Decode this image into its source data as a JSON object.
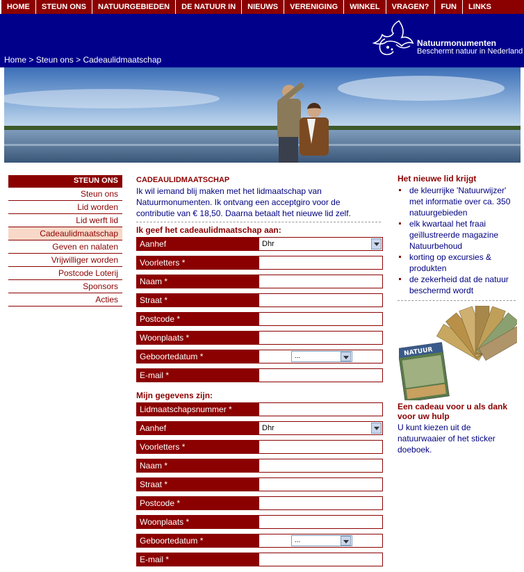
{
  "topnav": [
    "HOME",
    "STEUN ONS",
    "NATUURGEBIEDEN",
    "DE NATUUR IN",
    "NIEUWS",
    "VERENIGING",
    "WINKEL",
    "VRAGEN?",
    "FUN",
    "LINKS"
  ],
  "breadcrumb": {
    "home": "Home",
    "sep": " > ",
    "steun": "Steun ons",
    "current": "Cadeaulidmaatschap"
  },
  "logo": {
    "name": "Natuurmonumenten",
    "tagline": "Beschermt natuur in Nederland"
  },
  "sidebar": {
    "heading": "STEUN ONS",
    "items": [
      "Steun ons",
      "Lid worden",
      "Lid werft lid",
      "Cadeaulidmaatschap",
      "Geven en nalaten",
      "Vrijwilliger worden",
      "Postcode Loterij",
      "Sponsors",
      "Acties"
    ],
    "active_index": 3
  },
  "main": {
    "title": "CADEAULIDMAATSCHAP",
    "intro": "Ik wil iemand blij maken met het lidmaatschap van Natuurmonumenten. Ik ontvang een acceptgiro voor de contributie van € 18,50. Daarna betaalt het nieuwe lid zelf.",
    "form1_title": "Ik geef het cadeaulidmaatschap aan:",
    "form1": {
      "aanhef_label": "Aanhef",
      "aanhef_value": "Dhr",
      "voorletters": "Voorletters *",
      "naam": "Naam *",
      "straat": "Straat *",
      "postcode": "Postcode *",
      "woonplaats": "Woonplaats *",
      "geboortedatum": "Geboortedatum *",
      "geboortedatum_value": "...",
      "email": "E-mail *"
    },
    "form2_title": "Mijn gegevens zijn:",
    "form2": {
      "lidnummer": "Lidmaatschapsnummer *",
      "aanhef_label": "Aanhef",
      "aanhef_value": "Dhr",
      "voorletters": "Voorletters *",
      "naam": "Naam *",
      "straat": "Straat *",
      "postcode": "Postcode *",
      "woonplaats": "Woonplaats *",
      "geboortedatum": "Geboortedatum *",
      "geboortedatum_value": "...",
      "email": "E-mail *"
    }
  },
  "right": {
    "title": "Het nieuwe lid krijgt",
    "bullets": [
      "de kleurrijke 'Natuurwijzer' met informatie over ca. 350 natuurgebieden",
      "elk kwartaal het fraai geïllustreerde magazine Natuurbehoud",
      "korting op excursies & produkten",
      "de zekerheid dat de natuur beschermd wordt"
    ],
    "gift_title": "Een cadeau voor u als dank voor uw hulp",
    "gift_text": "U kunt kiezen uit de natuurwaaier of het sticker doeboek.",
    "magazine_label": "NATUUR"
  },
  "colors": {
    "nav": "#8b0000",
    "header": "#00008b",
    "text": "#000080",
    "accent": "#8b0000",
    "active": "#f8d8c8"
  }
}
